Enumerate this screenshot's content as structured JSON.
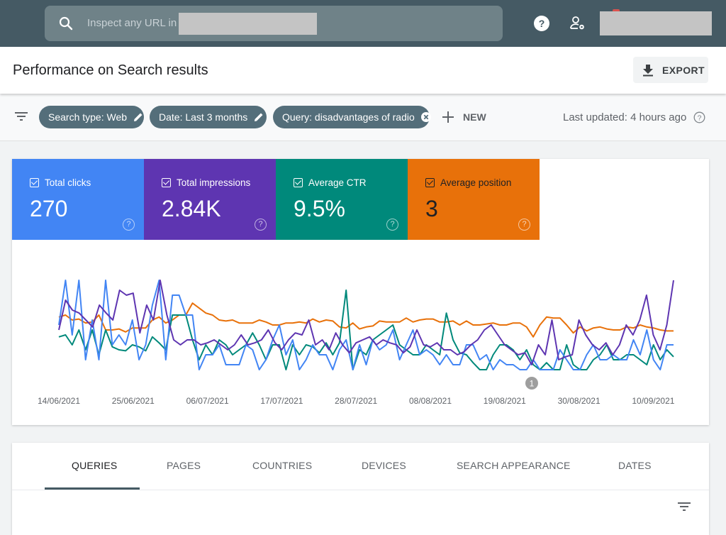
{
  "topbar": {
    "search_placeholder": "Inspect any URL in",
    "icons": [
      "search-icon",
      "help-icon",
      "account-settings-icon"
    ]
  },
  "header": {
    "title": "Performance on Search results",
    "export_label": "EXPORT"
  },
  "filters": {
    "chips": [
      {
        "label": "Search type: Web",
        "icon": "edit-icon"
      },
      {
        "label": "Date: Last 3 months",
        "icon": "edit-icon"
      },
      {
        "label": "Query: disadvantages of radio",
        "icon": "close-icon"
      }
    ],
    "new_label": "NEW",
    "last_updated": "Last updated: 4 hours ago"
  },
  "metrics": [
    {
      "label": "Total clicks",
      "value": "270",
      "color": "#4285f4",
      "checked": true
    },
    {
      "label": "Total impressions",
      "value": "2.84K",
      "color": "#5e35b1",
      "checked": true
    },
    {
      "label": "Average CTR",
      "value": "9.5%",
      "color": "#00897b",
      "checked": true
    },
    {
      "label": "Average position",
      "value": "3",
      "color": "#e8710a",
      "checked": true
    }
  ],
  "chart_data": {
    "type": "line",
    "title": "",
    "xlabel": "",
    "ylabel": "",
    "x_tick_labels": [
      "14/06/2021",
      "25/06/2021",
      "06/07/2021",
      "17/07/2021",
      "28/07/2021",
      "08/08/2021",
      "19/08/2021",
      "30/08/2021",
      "10/09/2021"
    ],
    "x_range": [
      "14/06/2021",
      "14/09/2021"
    ],
    "y_scale": "independent per series (normalized 0-1, no y-axis labels shown)",
    "annotation": {
      "label": "1",
      "near_date": "25/08/2021"
    },
    "series": [
      {
        "name": "Total clicks",
        "color": "#4285f4",
        "values": [
          0.5,
          0.95,
          0.4,
          0.95,
          0.15,
          0.55,
          0.15,
          0.95,
          0.3,
          0.4,
          0.3,
          0.55,
          0.15,
          0.3,
          0.7,
          0.95,
          0.15,
          0.8,
          0.8,
          0.6,
          0.6,
          0.05,
          0.2,
          0.2,
          0.3,
          0.1,
          0.1,
          0.1,
          0.3,
          0.25,
          0.05,
          0.15,
          0.35,
          0.5,
          0.2,
          0.35,
          0.05,
          0.15,
          0.3,
          0.2,
          0.2,
          0.05,
          0.25,
          0.35,
          0.05,
          0.3,
          0.1,
          0.35,
          0.25,
          0.3,
          0.45,
          0.15,
          0.3,
          0.45,
          0.2,
          0.25,
          0.2,
          0.1,
          0.2,
          0.1,
          0.1,
          0.3,
          0.3,
          0.15,
          0.2,
          0.05,
          0.15,
          0.1,
          0.1,
          0.05,
          0.05,
          0.15,
          0.05,
          0.05,
          0.05,
          0.25,
          0.15,
          0.05,
          0.05,
          0.2,
          0.3,
          0.15,
          0.15,
          0.2,
          0.15,
          0.15,
          0.35,
          0.2,
          0.45,
          0.15,
          0.05,
          0.3,
          0.3
        ]
      },
      {
        "name": "Total impressions",
        "color": "#5e35b1",
        "values": [
          0.45,
          0.75,
          0.65,
          0.62,
          0.55,
          0.48,
          0.7,
          0.62,
          0.55,
          0.85,
          0.8,
          0.82,
          0.42,
          0.7,
          0.55,
          0.95,
          0.6,
          0.35,
          0.3,
          0.35,
          0.35,
          0.3,
          0.32,
          0.35,
          0.3,
          0.25,
          0.3,
          0.4,
          0.3,
          0.32,
          0.35,
          0.45,
          0.32,
          0.25,
          0.35,
          0.42,
          0.4,
          0.55,
          0.3,
          0.35,
          0.25,
          0.42,
          0.3,
          0.22,
          0.32,
          0.35,
          0.38,
          0.3,
          0.35,
          0.32,
          0.3,
          0.22,
          0.28,
          0.45,
          0.3,
          0.28,
          0.32,
          0.25,
          0.25,
          0.2,
          0.23,
          0.3,
          0.35,
          0.45,
          0.5,
          0.4,
          0.3,
          0.25,
          0.2,
          0.22,
          0.1,
          0.3,
          0.2,
          0.55,
          0.15,
          0.18,
          0.2,
          0.55,
          0.4,
          0.3,
          0.25,
          0.32,
          0.2,
          0.3,
          0.5,
          0.4,
          0.55,
          0.8,
          0.4,
          0.25,
          0.5,
          0.95
        ]
      },
      {
        "name": "Average CTR",
        "color": "#00897b",
        "values": [
          0.38,
          0.4,
          0.3,
          0.45,
          0.25,
          0.45,
          0.2,
          0.45,
          0.28,
          0.25,
          0.24,
          0.3,
          0.28,
          0.24,
          0.38,
          0.32,
          0.25,
          0.6,
          0.6,
          0.6,
          0.35,
          0.15,
          0.3,
          0.2,
          0.35,
          0.3,
          0.2,
          0.25,
          0.3,
          0.42,
          0.3,
          0.15,
          0.3,
          0.3,
          0.05,
          0.3,
          0.2,
          0.3,
          0.28,
          0.22,
          0.32,
          0.2,
          0.32,
          0.85,
          0.05,
          0.25,
          0.2,
          0.35,
          0.4,
          0.45,
          0.5,
          0.3,
          0.25,
          0.2,
          0.2,
          0.3,
          0.25,
          0.2,
          0.62,
          0.35,
          0.22,
          0.2,
          0.12,
          0.05,
          0.05,
          0.2,
          0.3,
          0.3,
          0.25,
          0.15,
          0.25,
          0.1,
          0.05,
          0.12,
          0.05,
          0.05,
          0.3,
          0.1,
          0.05,
          0.05,
          0.15,
          0.2,
          0.3,
          0.15,
          0.15,
          0.2,
          0.2,
          0.15,
          0.1,
          0.3,
          0.15,
          0.25,
          0.18
        ]
      },
      {
        "name": "Average position",
        "color": "#e8710a",
        "values": [
          0.58,
          0.6,
          0.55,
          0.56,
          0.52,
          0.53,
          0.6,
          0.45,
          0.45,
          0.46,
          0.43,
          0.47,
          0.47,
          0.47,
          0.55,
          0.58,
          0.52,
          0.55,
          0.6,
          0.6,
          0.72,
          0.67,
          0.62,
          0.6,
          0.55,
          0.54,
          0.55,
          0.52,
          0.52,
          0.52,
          0.55,
          0.53,
          0.5,
          0.5,
          0.52,
          0.52,
          0.53,
          0.52,
          0.56,
          0.53,
          0.55,
          0.54,
          0.48,
          0.47,
          0.52,
          0.46,
          0.48,
          0.49,
          0.54,
          0.53,
          0.53,
          0.53,
          0.57,
          0.53,
          0.55,
          0.56,
          0.56,
          0.53,
          0.53,
          0.54,
          0.5,
          0.54,
          0.5,
          0.5,
          0.51,
          0.52,
          0.5,
          0.5,
          0.52,
          0.52,
          0.48,
          0.38,
          0.5,
          0.58,
          0.57,
          0.57,
          0.5,
          0.42,
          0.48,
          0.44,
          0.47,
          0.48,
          0.46,
          0.45,
          0.45,
          0.48,
          0.47,
          0.5,
          0.48,
          0.47,
          0.45,
          0.44,
          0.44
        ]
      }
    ]
  },
  "tabs": {
    "items": [
      "QUERIES",
      "PAGES",
      "COUNTRIES",
      "DEVICES",
      "SEARCH APPEARANCE",
      "DATES"
    ],
    "active": "QUERIES"
  }
}
